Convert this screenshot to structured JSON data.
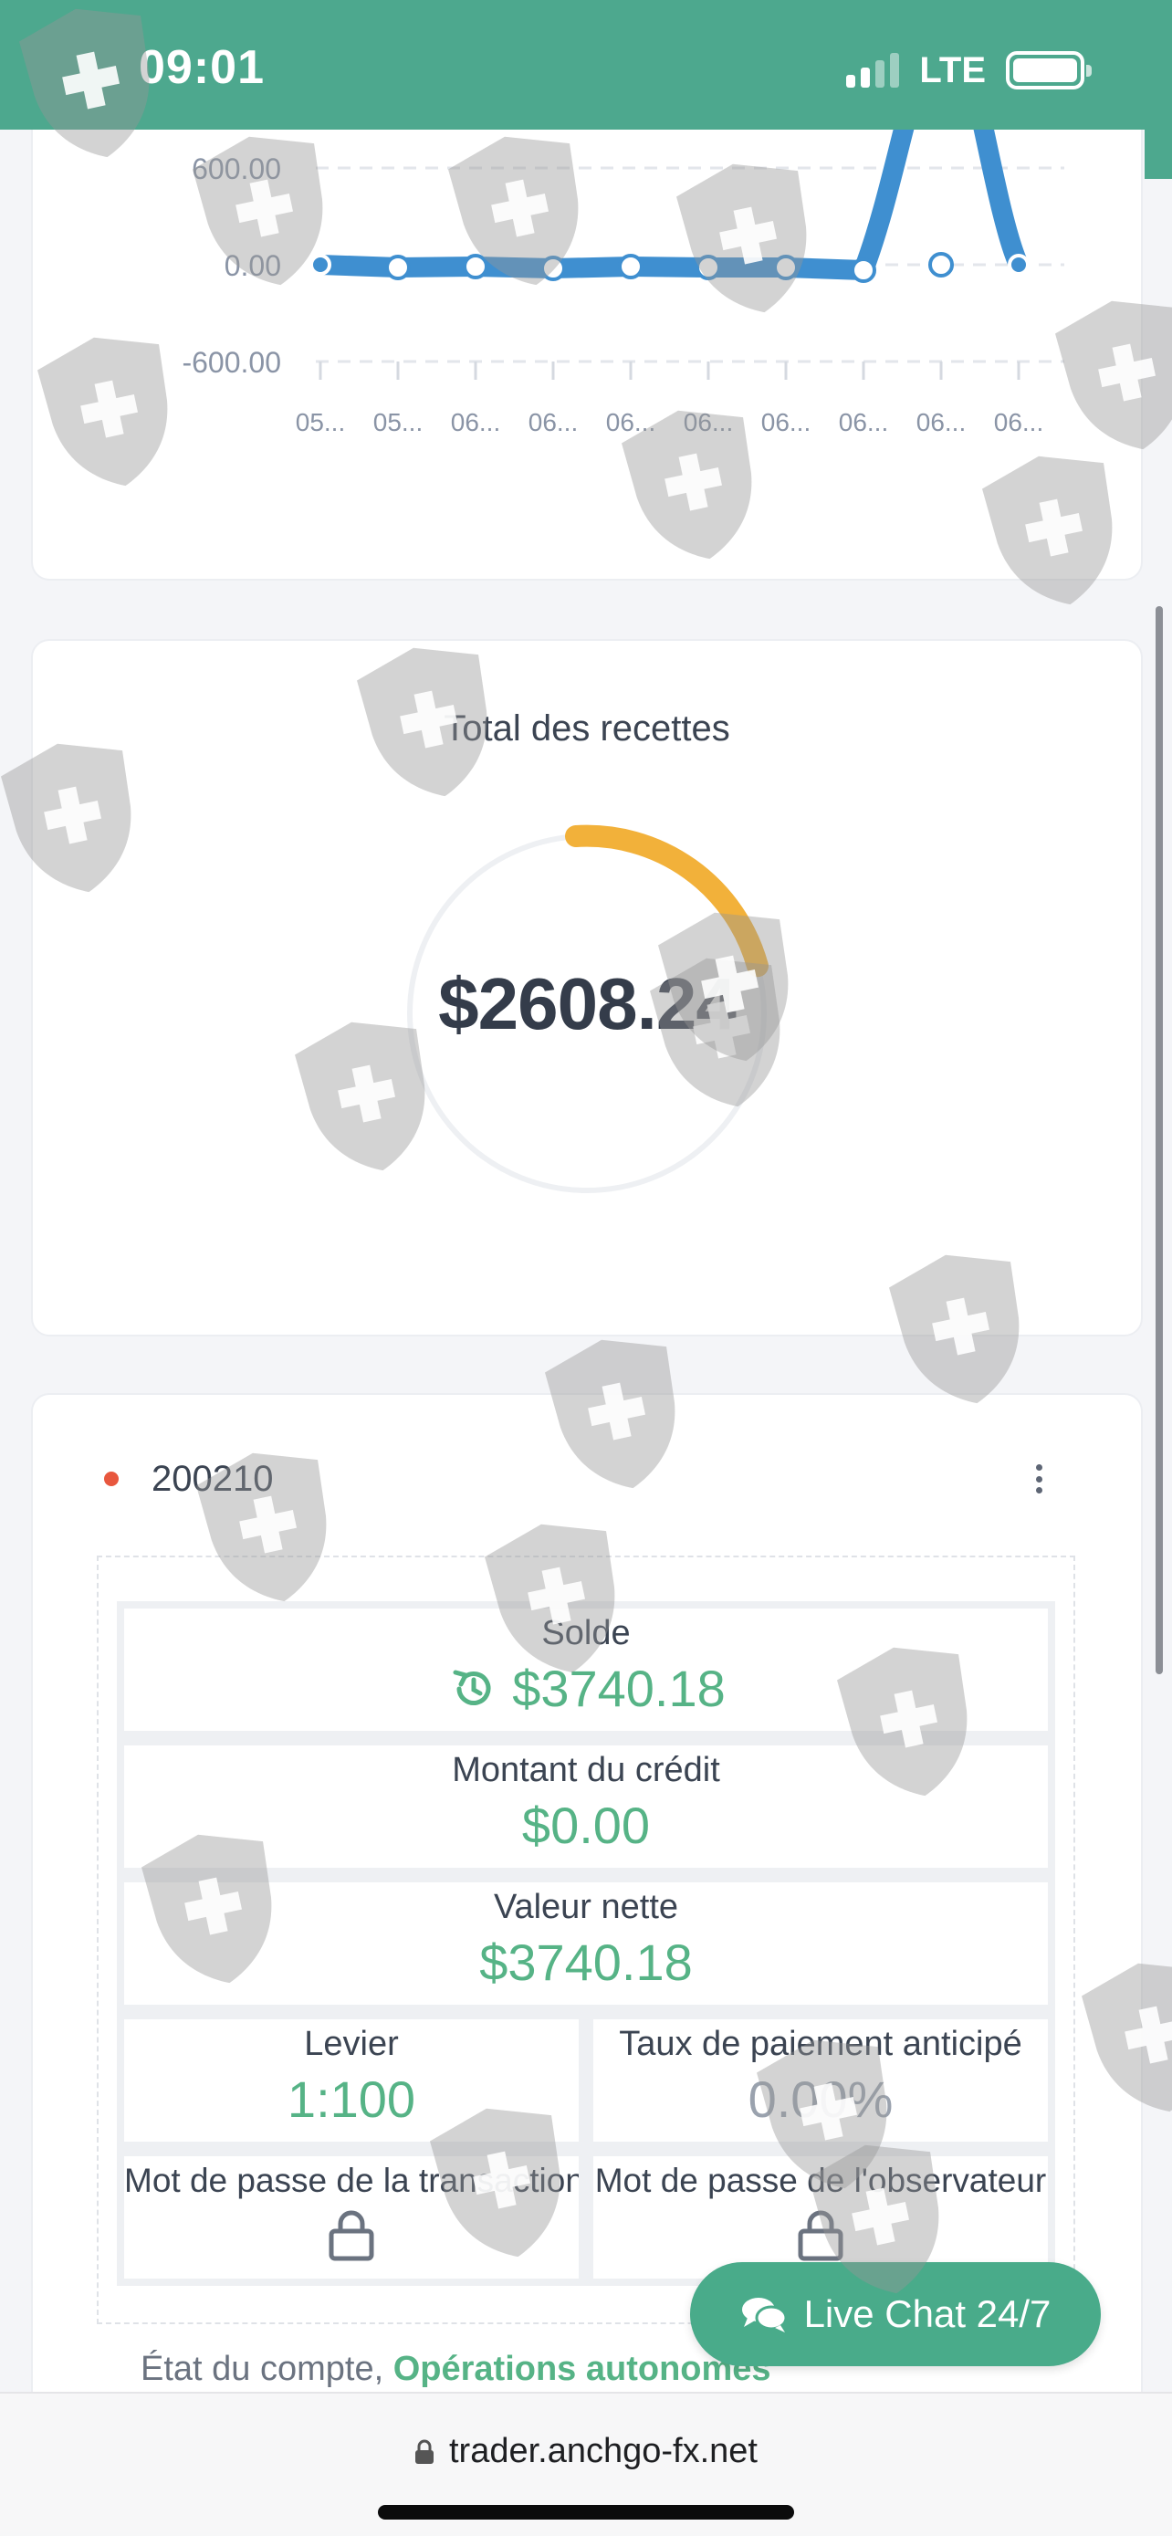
{
  "status_bar": {
    "time": "09:01",
    "network": "LTE",
    "icons": [
      "signal-icon",
      "battery-icon"
    ]
  },
  "earnings_chart": {
    "y_ticks": [
      "600.00",
      "0.00",
      "-600.00"
    ],
    "x_ticks": [
      "05...",
      "05...",
      "06...",
      "06...",
      "06...",
      "06...",
      "06...",
      "06...",
      "06...",
      "06..."
    ],
    "line_color": "#3f8fd0"
  },
  "total": {
    "title": "Total des recettes",
    "value": "$2608.24",
    "gauge_fraction": 0.18,
    "gauge_color": "#f2b13a"
  },
  "account": {
    "id": "200210",
    "status_dot_color": "#e8573e",
    "balance_label": "Solde",
    "balance_value": "$3740.18",
    "credit_label": "Montant du crédit",
    "credit_value": "$0.00",
    "net_label": "Valeur nette",
    "net_value": "$3740.18",
    "leverage_label": "Levier",
    "leverage_value": "1:100",
    "prepay_label": "Taux de paiement anticipé",
    "prepay_value": "0.00%",
    "trade_password_label": "Mot de passe de la transaction",
    "observer_password_label": "Mot de passe de l'observateur",
    "state_label": "État du compte,",
    "state_value": "Opérations autonomes",
    "accent_color": "#56b386"
  },
  "live_chat": {
    "label": "Live Chat 24/7"
  },
  "browser": {
    "url": "trader.anchgo-fx.net"
  }
}
